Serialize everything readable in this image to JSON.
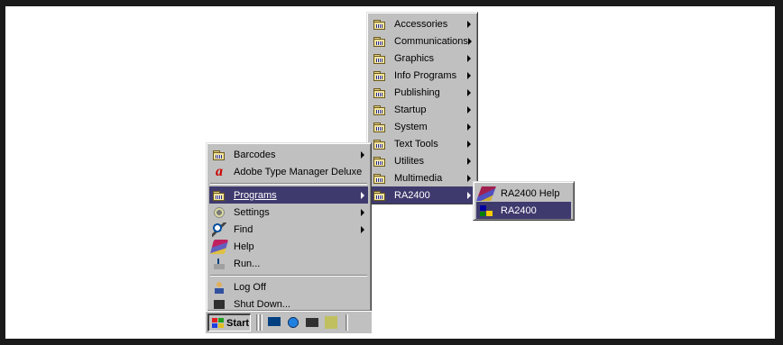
{
  "start_menu": {
    "items": [
      {
        "label": "Barcodes",
        "icon": "folder-icon",
        "submenu": true
      },
      {
        "label": "Adobe Type Manager Deluxe",
        "icon": "adobe-icon",
        "submenu": false
      },
      {
        "label": "Programs",
        "icon": "folder-icon",
        "submenu": true,
        "selected": true
      },
      {
        "label": "Settings",
        "icon": "settings-icon",
        "submenu": true
      },
      {
        "label": "Find",
        "icon": "find-icon",
        "submenu": true
      },
      {
        "label": "Help",
        "icon": "help-icon",
        "submenu": false
      },
      {
        "label": "Run...",
        "icon": "run-icon",
        "submenu": false
      },
      {
        "label": "Log Off",
        "icon": "log-off-icon",
        "submenu": false
      },
      {
        "label": "Shut Down...",
        "icon": "shut-down-icon",
        "submenu": false
      }
    ]
  },
  "programs_menu": {
    "items": [
      {
        "label": "Accessories"
      },
      {
        "label": "Communications"
      },
      {
        "label": "Graphics"
      },
      {
        "label": "Info Programs"
      },
      {
        "label": "Publishing"
      },
      {
        "label": "Startup"
      },
      {
        "label": "System"
      },
      {
        "label": "Text Tools"
      },
      {
        "label": "Utilites"
      },
      {
        "label": "Multimedia"
      },
      {
        "label": "RA2400",
        "selected": true
      }
    ]
  },
  "ra2400_menu": {
    "items": [
      {
        "label": "RA2400 Help",
        "icon": "help-book-icon"
      },
      {
        "label": "RA2400",
        "icon": "application-icon",
        "selected": true
      }
    ]
  },
  "taskbar": {
    "start_label": "Start",
    "quick_launch": [
      "show-desktop-icon",
      "internet-explorer-icon",
      "outlook-express-icon",
      "channels-icon"
    ]
  },
  "colors": {
    "menu_bg": "#c0c0c0",
    "highlight": "#3f3a6e",
    "frame": "#1a1a1a"
  }
}
